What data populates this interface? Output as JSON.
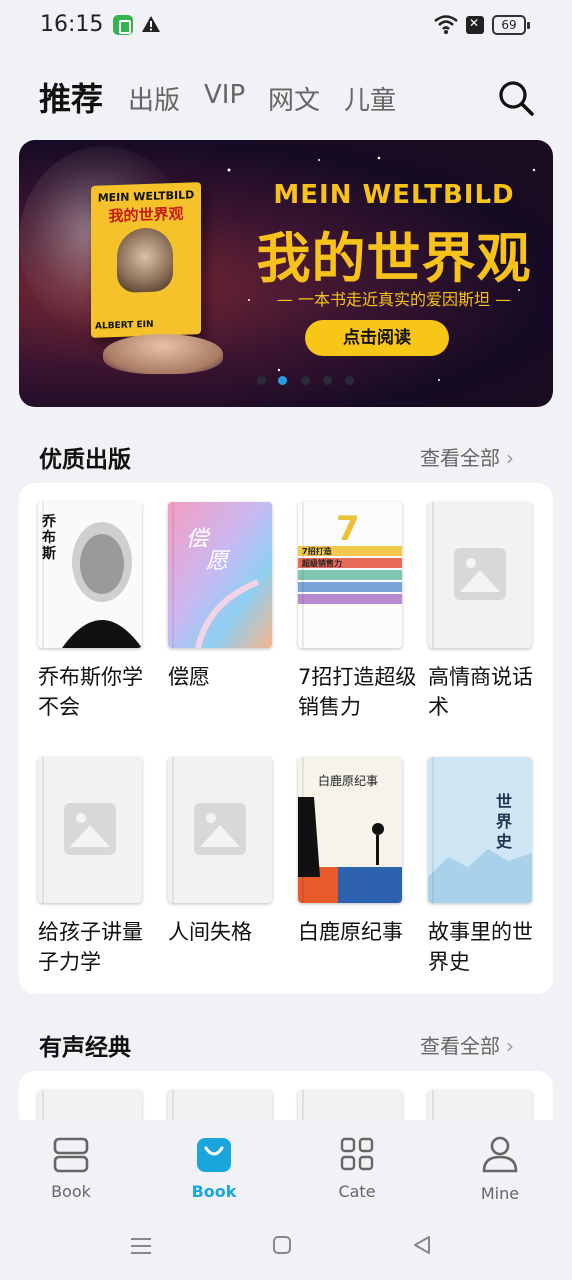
{
  "status": {
    "time": "16:15",
    "battery": "69"
  },
  "tabs": [
    "推荐",
    "出版",
    "VIP",
    "网文",
    "儿童"
  ],
  "banner": {
    "en_title": "MEIN WELTBILD",
    "cn_title": "我的世界观",
    "subtitle": "— 一本书走近真实的爱因斯坦 —",
    "button": "点击阅读",
    "book_en": "MEIN WELTBILD",
    "book_cn": "我的世界观",
    "book_author": "ALBERT EIN",
    "active_slide": 1
  },
  "sections": [
    {
      "title": "优质出版",
      "see_all": "查看全部"
    },
    {
      "title": "有声经典",
      "see_all": "查看全部"
    }
  ],
  "books": [
    {
      "title": "乔布斯你学不会",
      "cover": "jobs"
    },
    {
      "title": "偿愿",
      "cover": "pastel"
    },
    {
      "title": "7招打造超级销售力",
      "cover": "sales"
    },
    {
      "title": "高情商说话术",
      "cover": "placeholder"
    },
    {
      "title": "给孩子讲量子力学",
      "cover": "placeholder"
    },
    {
      "title": "人间失格",
      "cover": "placeholder"
    },
    {
      "title": "白鹿原纪事",
      "cover": "whitedeer"
    },
    {
      "title": "故事里的世界史",
      "cover": "history"
    }
  ],
  "bottom_nav": [
    {
      "label": "Book",
      "icon": "bookshelf-icon",
      "active": false
    },
    {
      "label": "Book",
      "icon": "shopping-bag-icon",
      "active": true
    },
    {
      "label": "Cate",
      "icon": "grid-icon",
      "active": false
    },
    {
      "label": "Mine",
      "icon": "person-icon",
      "active": false
    }
  ],
  "colors": {
    "accent": "#1aa6dd",
    "banner_gold": "#f7c31a",
    "page_bg": "#f1f2f5"
  }
}
